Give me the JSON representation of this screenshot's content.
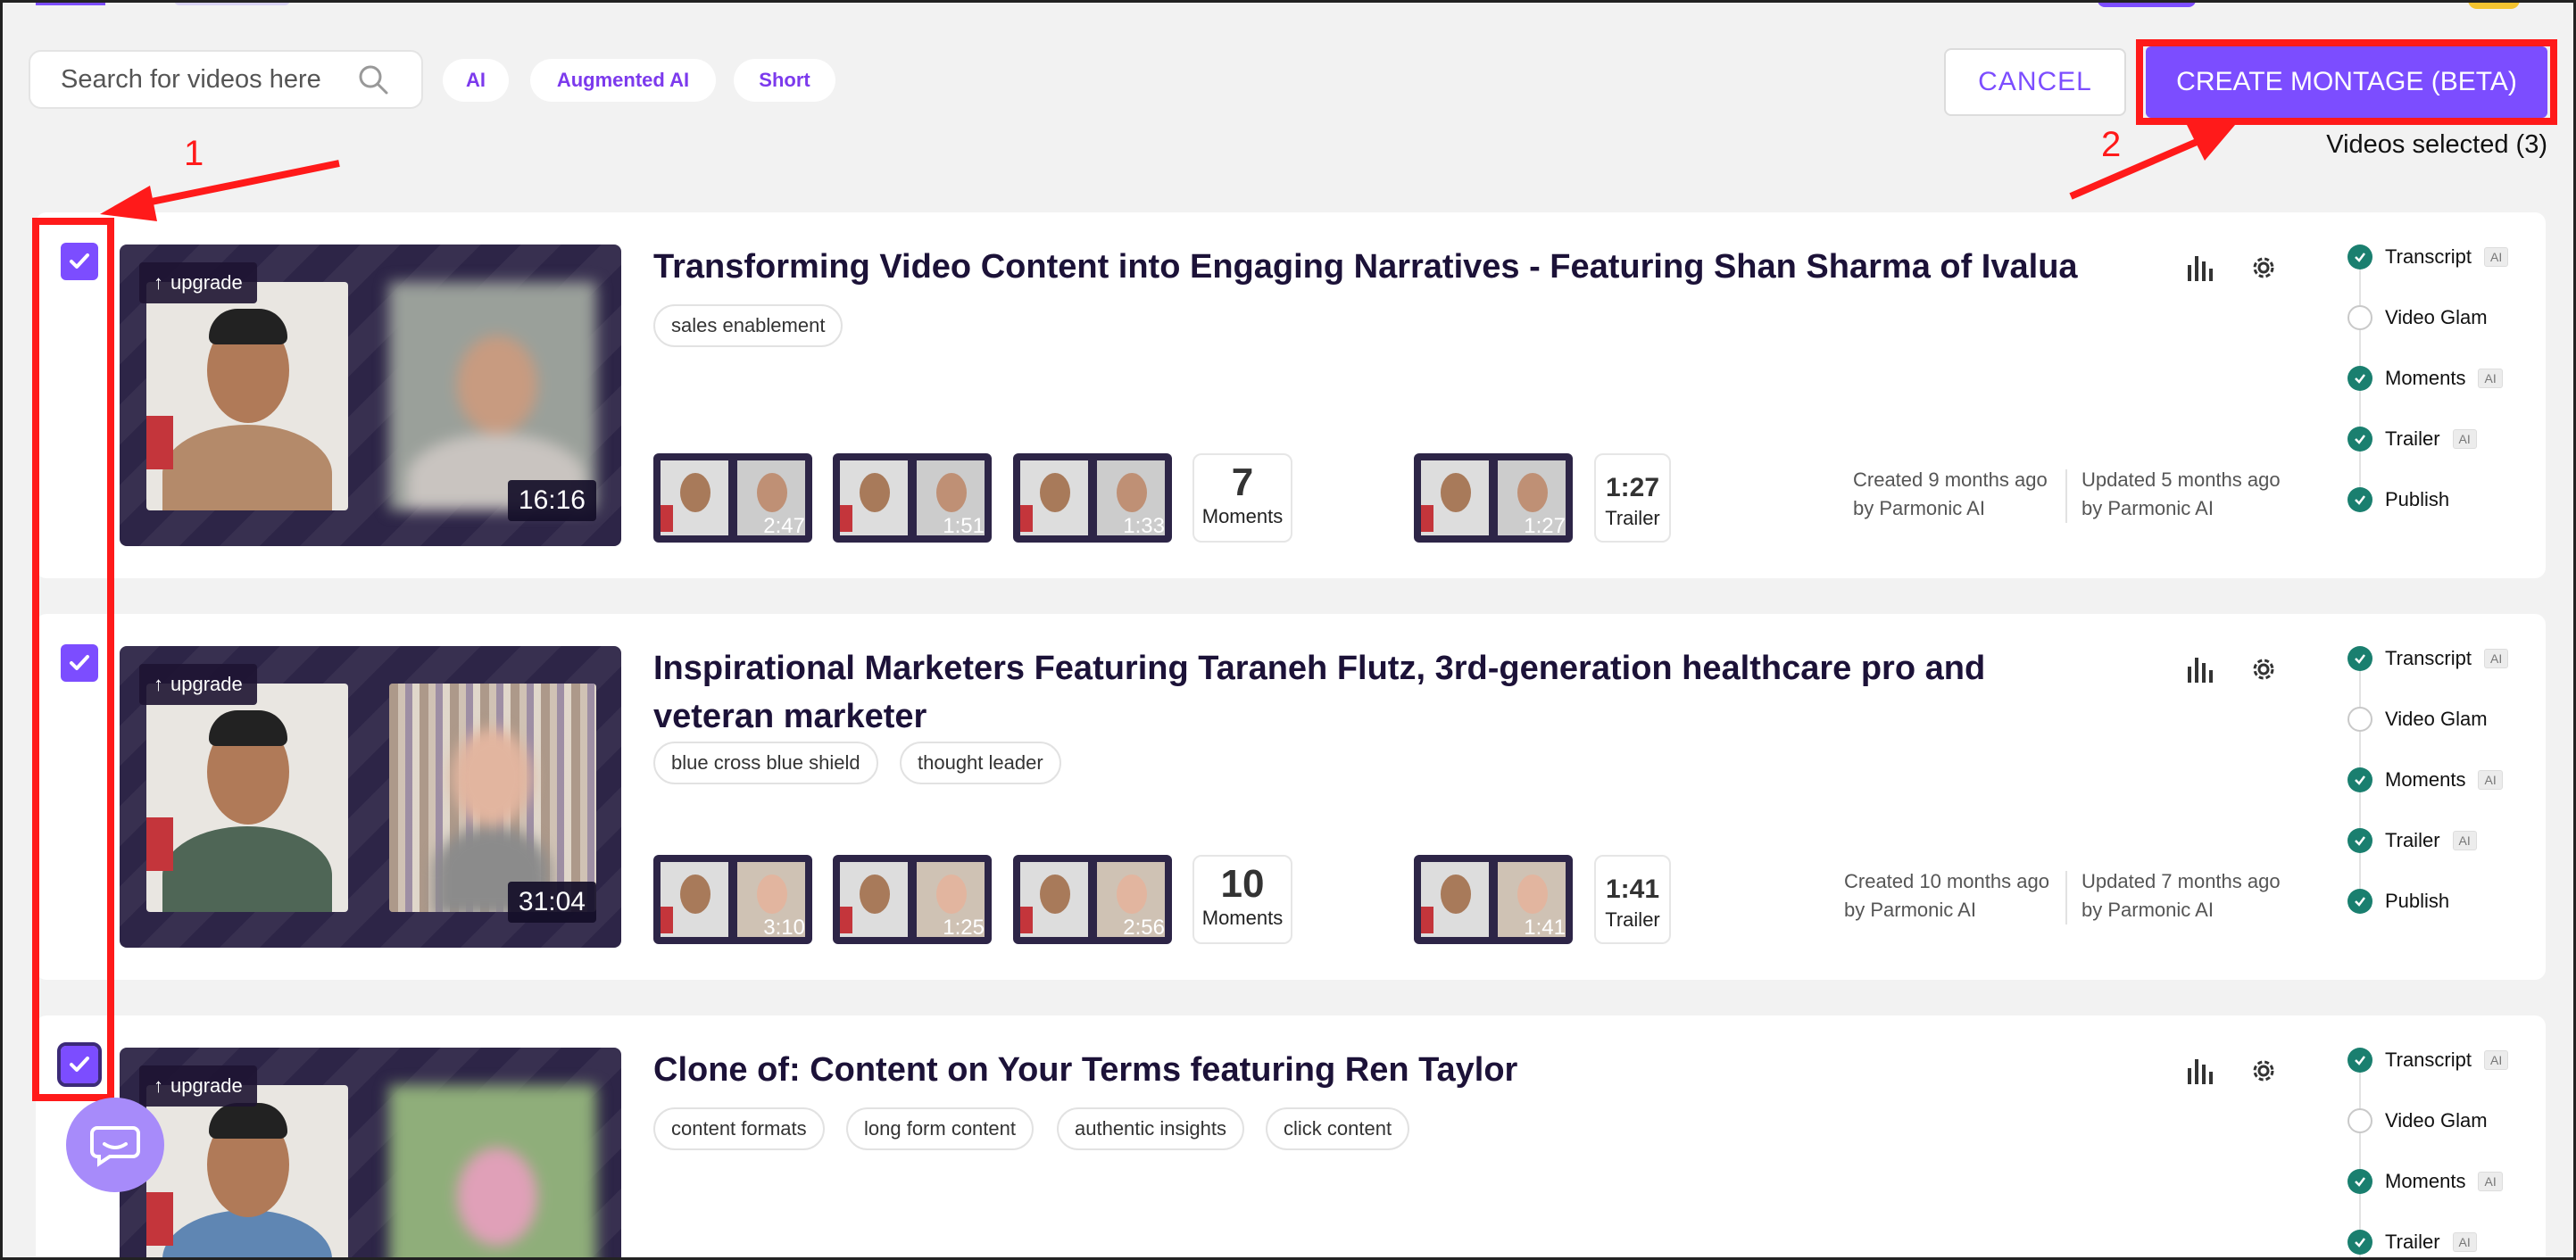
{
  "search": {
    "placeholder": "Search for videos here"
  },
  "filters": [
    "AI",
    "Augmented AI",
    "Short"
  ],
  "actions": {
    "cancel": "CANCEL",
    "create": "CREATE MONTAGE (BETA)",
    "selected": "Videos selected (3)"
  },
  "annotations": {
    "one": "1",
    "two": "2"
  },
  "colors": {
    "accent": "#7c4dff",
    "highlight": "#ff1a1a",
    "done": "#1a7f6f"
  },
  "videos": [
    {
      "title": "Transforming Video Content into Engaging Narratives - Featuring Shan Sharma of Ivalua",
      "tags": [
        "sales enablement"
      ],
      "upgrade": "upgrade",
      "duration": "16:16",
      "moments": [
        "2:47",
        "1:51",
        "1:33"
      ],
      "moments_count": "7",
      "moments_label": "Moments",
      "trailer_thumb": "1:27",
      "trailer_length": "1:27",
      "trailer_label": "Trailer",
      "created": "Created 9 months ago",
      "created_by": "by Parmonic AI",
      "updated": "Updated 5 months ago",
      "updated_by": "by Parmonic AI",
      "selected": true
    },
    {
      "title": "Inspirational Marketers Featuring Taraneh Flutz, 3rd-generation healthcare pro and veteran marketer",
      "tags": [
        "blue cross blue shield",
        "thought leader"
      ],
      "upgrade": "upgrade",
      "duration": "31:04",
      "moments": [
        "3:10",
        "1:25",
        "2:56"
      ],
      "moments_count": "10",
      "moments_label": "Moments",
      "trailer_thumb": "1:41",
      "trailer_length": "1:41",
      "trailer_label": "Trailer",
      "created": "Created 10 months ago",
      "created_by": "by Parmonic AI",
      "updated": "Updated 7 months ago",
      "updated_by": "by Parmonic AI",
      "selected": true
    },
    {
      "title": "Clone of: Content on Your Terms featuring Ren Taylor",
      "tags": [
        "content formats",
        "long form content",
        "authentic insights",
        "click content"
      ],
      "upgrade": "upgrade",
      "selected": true
    }
  ],
  "steps": {
    "transcript": "Transcript",
    "video_glam": "Video Glam",
    "moments": "Moments",
    "trailer": "Trailer",
    "publish": "Publish",
    "ai_badge": "AI"
  }
}
